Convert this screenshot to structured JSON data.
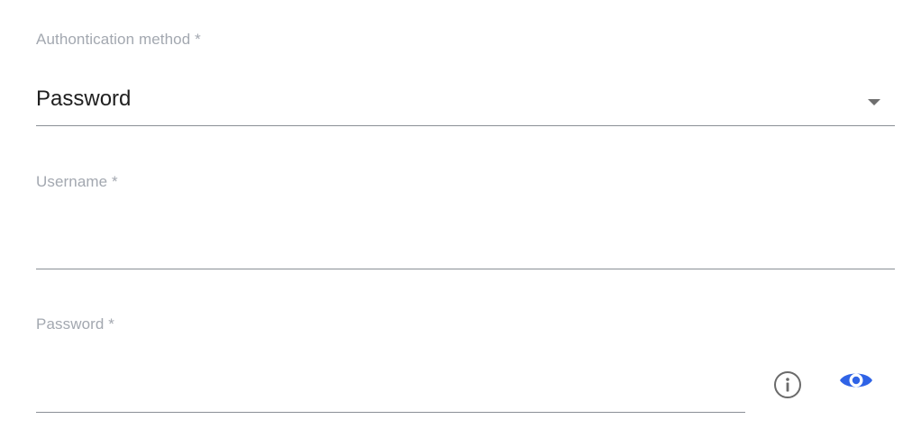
{
  "auth_method": {
    "label": "Authontication method *",
    "value": "Password",
    "arrow_icon": "caret-down-icon"
  },
  "username": {
    "label": "Username *",
    "value": ""
  },
  "password": {
    "label": "Password *",
    "value": "",
    "info_icon": "info-icon",
    "visibility_icon": "eye-icon"
  },
  "colors": {
    "label": "#a3a8b0",
    "underline": "#8a8f96",
    "text": "#1f1f1f",
    "info_icon": "#6a6a6a",
    "eye_icon": "#2f63e6"
  }
}
